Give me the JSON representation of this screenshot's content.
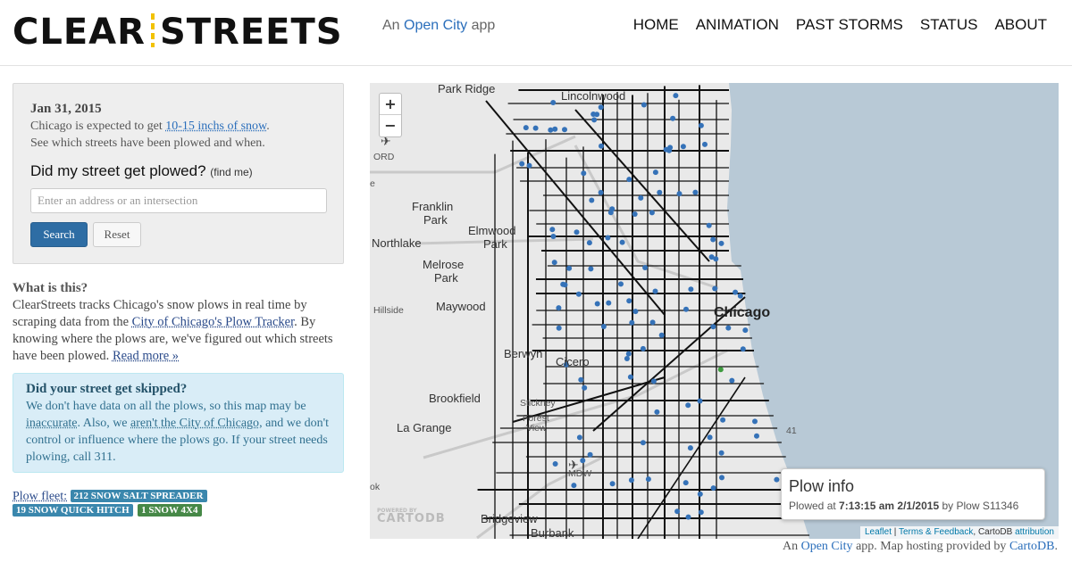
{
  "header": {
    "logo_left": "CLEAR",
    "logo_right": "STREETS",
    "tagline_prefix": "An",
    "tagline_link": "Open City",
    "tagline_suffix": "app",
    "nav": [
      "HOME",
      "ANIMATION",
      "PAST STORMS",
      "STATUS",
      "ABOUT"
    ]
  },
  "search_panel": {
    "date": "Jan 31, 2015",
    "expect_prefix": "Chicago is expected to get",
    "expect_link": "10-15 inchs of snow",
    "expect_suffix": ".",
    "expect_line2": "See which streets have been plowed and when.",
    "question": "Did my street get plowed?",
    "find_me": "(find me)",
    "input_placeholder": "Enter an address or an intersection",
    "input_value": "",
    "search_label": "Search",
    "reset_label": "Reset"
  },
  "about": {
    "title": "What is this?",
    "text1": "ClearStreets tracks Chicago's snow plows in real time by scraping data from the",
    "link1": "City of Chicago's Plow Tracker",
    "text2": ". By knowing where the plows are, we've figured out which streets have been plowed.",
    "read_more": "Read more »"
  },
  "alert": {
    "title": "Did your street get skipped?",
    "text1": "We don't have data on all the plows, so this map may be",
    "link1": "inaccurate",
    "text2": ". Also, we",
    "link2": "aren't the City of Chicago",
    "text3": ", and we don't control or influence where the plows go. If your street needs plowing, call 311."
  },
  "fleet": {
    "label": "Plow fleet:",
    "badges": [
      "212 SNOW SALT SPREADER",
      "19 SNOW QUICK HITCH",
      "1 SNOW 4X4"
    ],
    "colors": {
      "spreader": "#3a87ad",
      "hitch": "#3a87ad",
      "four_by_four": "#468847"
    }
  },
  "map": {
    "zoom_in": "+",
    "zoom_out": "−",
    "places": {
      "park_ridge": "Park Ridge",
      "lincolnwood": "Lincolnwood",
      "ord": "ORD",
      "franklin": "Franklin",
      "franklin_park": "Park",
      "elmwood": "Elmwood",
      "elmwood_park": "Park",
      "northlake": "Northlake",
      "melrose": "Melrose",
      "melrose_park": "Park",
      "hillside": "Hillside",
      "maywood": "Maywood",
      "chicago": "Chicago",
      "berwyn": "Berwyn",
      "cicero": "Cicero",
      "brookfield": "Brookfield",
      "stickney": "Stickney",
      "forest": "Forest",
      "forest_view": "View",
      "la_grange": "La Grange",
      "mdw": "MDW",
      "bridgeview": "Bridgeview",
      "burbank": "Burbank",
      "num41": "41",
      "fragment_e": "e",
      "fragment_ok": "ok"
    },
    "cartodb_small": "POWERED BY",
    "cartodb": "CARTODB",
    "colors": {
      "lake": "#b8c9d6",
      "land": "#e9e9e9",
      "plowed_street": "#111111",
      "plow_marker": "#3572b8",
      "plow_marker_alt": "#3e9b3e"
    },
    "info": {
      "title": "Plow info",
      "plowed_label": "Plowed at",
      "time": "7:13:15 am 2/1/2015",
      "by_label": "by Plow",
      "plow_id": "S11346"
    },
    "attribution": {
      "leaflet": "Leaflet",
      "sep": "|",
      "terms": "Terms & Feedback",
      "cartodb": "CartoDB",
      "attribution_link": "attribution"
    }
  },
  "footer": {
    "prefix": "An",
    "open_city": "Open City",
    "middle": "app. Map hosting provided by",
    "cartodb": "CartoDB",
    "suffix": "."
  }
}
